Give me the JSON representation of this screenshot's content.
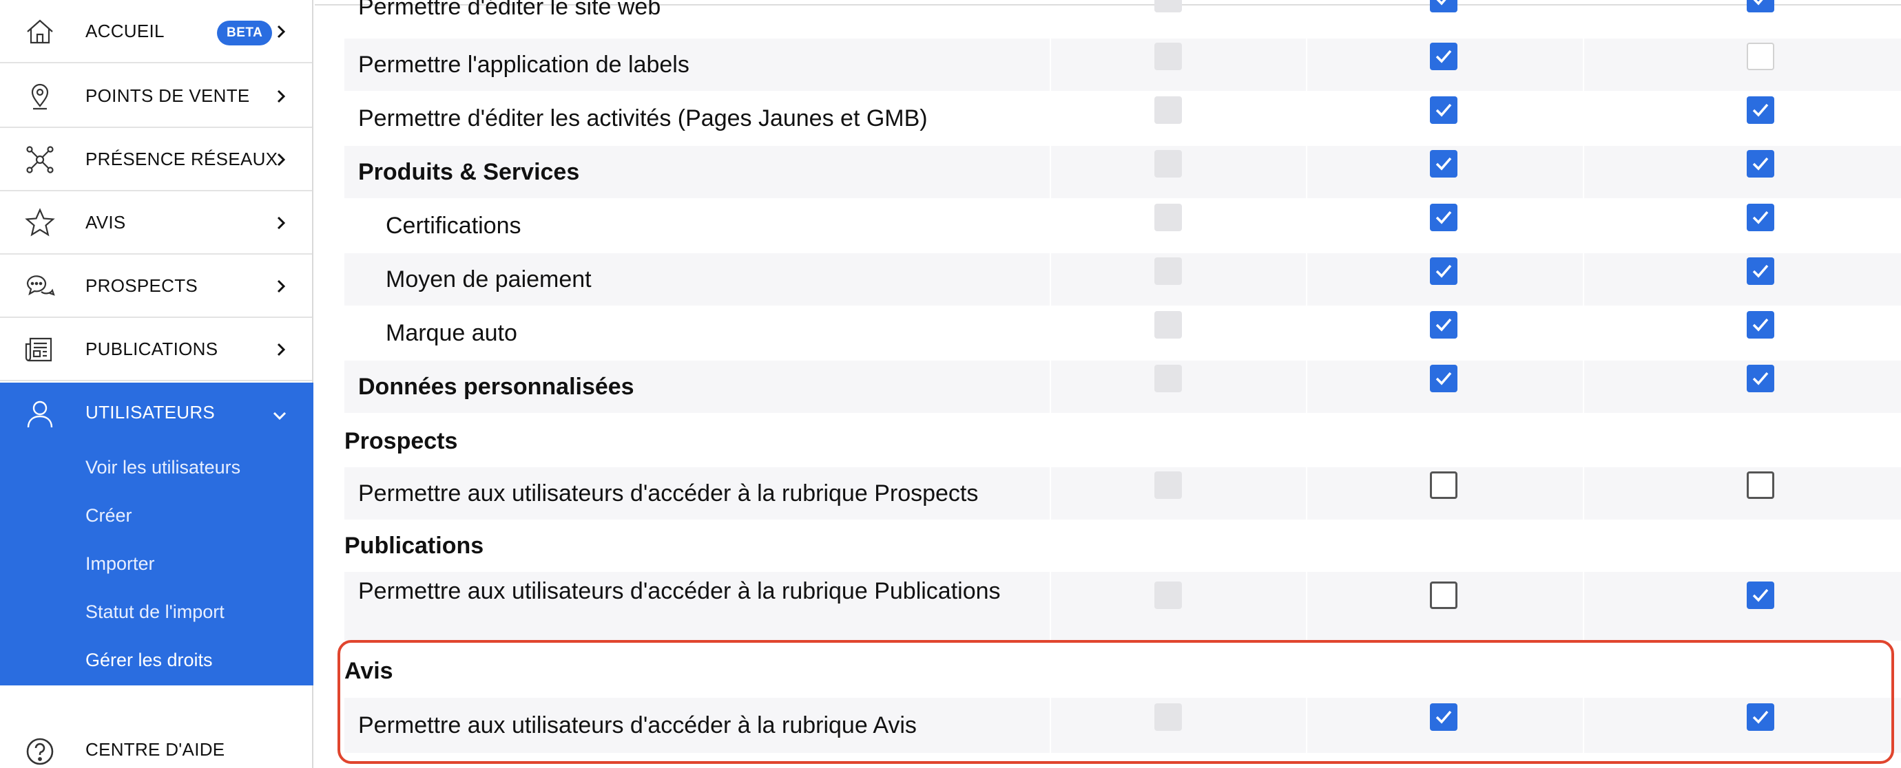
{
  "sidebar": {
    "items": [
      {
        "label": "ACCUEIL",
        "icon": "home-icon",
        "badge": "BETA"
      },
      {
        "label": "POINTS DE VENTE",
        "icon": "map-pin-icon"
      },
      {
        "label": "PRÉSENCE RÉSEAUX",
        "icon": "network-icon"
      },
      {
        "label": "AVIS",
        "icon": "star-icon"
      },
      {
        "label": "PROSPECTS",
        "icon": "chat-bubbles-icon"
      },
      {
        "label": "PUBLICATIONS",
        "icon": "newspaper-icon"
      }
    ],
    "active": {
      "label": "UTILISATEURS",
      "icon": "user-icon",
      "subitems": [
        "Voir les utilisateurs",
        "Créer",
        "Importer",
        "Statut de l'import",
        "Gérer les droits"
      ]
    },
    "help": {
      "label": "CENTRE D'AIDE",
      "icon": "help-circle-icon"
    }
  },
  "permissions": {
    "rows": [
      {
        "label": "Permettre d'éditer le site web",
        "a": "disabled",
        "b": "on",
        "c": "on"
      },
      {
        "label": "Permettre l'application de labels",
        "a": "disabled",
        "b": "on",
        "c": "lightoff"
      },
      {
        "label": "Permettre d'éditer les activités (Pages Jaunes et GMB)",
        "a": "disabled",
        "b": "on",
        "c": "on"
      },
      {
        "label": "Produits & Services",
        "a": "disabled",
        "b": "on",
        "c": "on"
      },
      {
        "label": "Certifications",
        "a": "disabled",
        "b": "on",
        "c": "on"
      },
      {
        "label": "Moyen de paiement",
        "a": "disabled",
        "b": "on",
        "c": "on"
      },
      {
        "label": "Marque auto",
        "a": "disabled",
        "b": "on",
        "c": "on"
      },
      {
        "label": "Données personnalisées",
        "a": "disabled",
        "b": "on",
        "c": "on"
      },
      {
        "label": "Prospects"
      },
      {
        "label": "Permettre aux utilisateurs d'accéder à la rubrique Prospects",
        "a": "disabled",
        "b": "off",
        "c": "off"
      },
      {
        "label": "Publications"
      },
      {
        "label": "Permettre aux utilisateurs d'accéder à la rubrique Publications",
        "a": "disabled",
        "b": "off",
        "c": "on"
      },
      {
        "label": "Avis"
      },
      {
        "label": "Permettre aux utilisateurs d'accéder à la rubrique Avis",
        "a": "disabled",
        "b": "on",
        "c": "on"
      }
    ]
  },
  "colors": {
    "accent": "#2a6de0",
    "highlight": "#e0452e"
  }
}
